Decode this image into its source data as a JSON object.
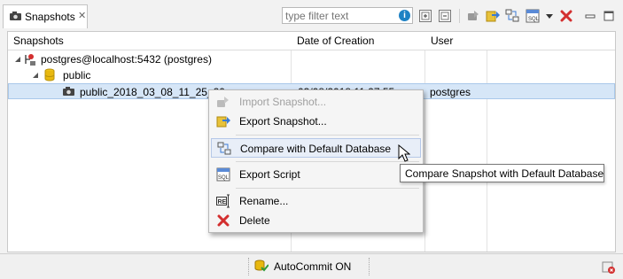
{
  "view": {
    "tab_title": "Snapshots",
    "tab_close": "✕",
    "filter_placeholder": "type filter text",
    "filter_info": "i"
  },
  "table": {
    "columns": [
      "Snapshots",
      "Date of Creation",
      "User"
    ],
    "tree": [
      {
        "label": "postgres@localhost:5432 (postgres)"
      },
      {
        "label": "public"
      },
      {
        "label": "public_2018_03_08_11_25_20",
        "date": "03/08/2018 11:27:55",
        "user": "postgres",
        "selected": true
      }
    ]
  },
  "context_menu": {
    "items": [
      {
        "label": "Import Snapshot...",
        "enabled": false
      },
      {
        "label": "Export Snapshot...",
        "enabled": true
      },
      {
        "label": "Compare with Default Database",
        "enabled": true,
        "hovered": true
      },
      {
        "label": "Export Script",
        "enabled": true
      },
      {
        "label": "Rename...",
        "enabled": true
      },
      {
        "label": "Delete",
        "enabled": true
      }
    ]
  },
  "tooltip": "Compare Snapshot with Default Database",
  "status_bar": {
    "autocommit": "AutoCommit ON"
  },
  "colors": {
    "selection": "#d6e6f7",
    "delete_red": "#d32f2f",
    "info_blue": "#1e82c4"
  }
}
